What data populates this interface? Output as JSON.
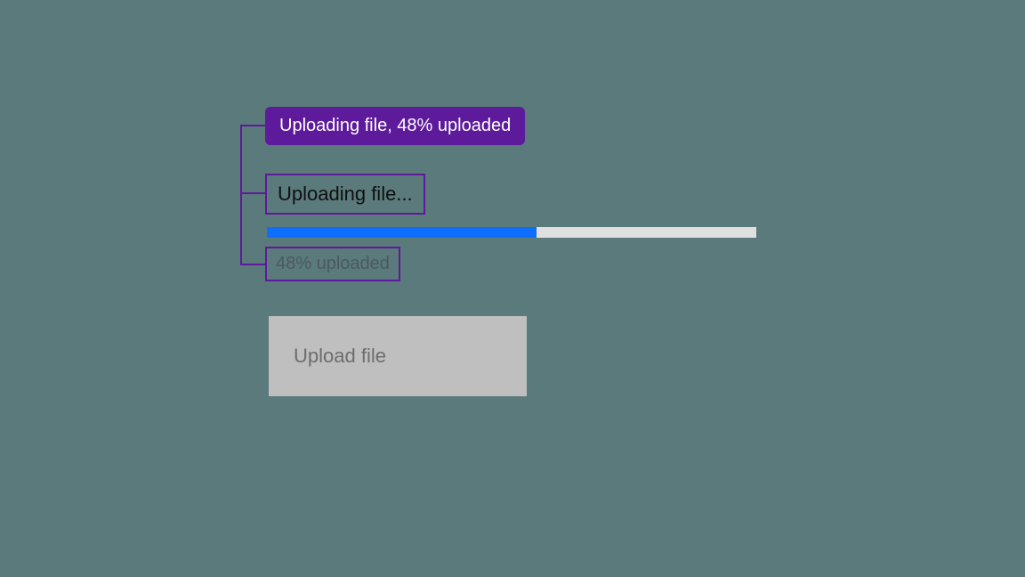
{
  "announcement": {
    "combined": "Uploading file, 48% uploaded"
  },
  "progress": {
    "label": "Uploading file...",
    "percent_text": "48% uploaded",
    "percent": 48,
    "fill_pct": "55%"
  },
  "button": {
    "label": "Upload file"
  },
  "colors": {
    "purple": "#5d1a9a",
    "blue": "#0d6efd",
    "track": "#e0e0e0",
    "button_bg": "#bfbfbf"
  }
}
